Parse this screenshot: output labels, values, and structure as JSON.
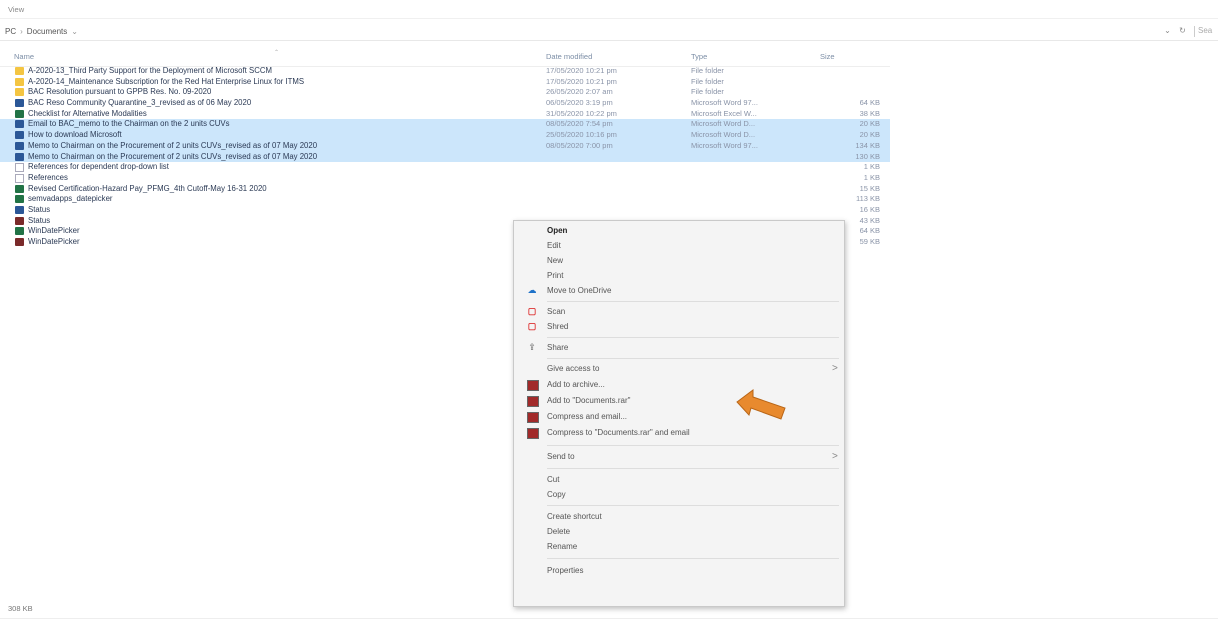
{
  "menubar": {
    "label": "View"
  },
  "address": {
    "crumbs": [
      "PC",
      "Documents"
    ],
    "refresh_glyph": "↻",
    "search_text": "Sea"
  },
  "columns": {
    "name": "Name",
    "date": "Date modified",
    "type": "Type",
    "size": "Size"
  },
  "files": [
    {
      "icon": "folder",
      "name": "A-2020-13_Third Party Support for the Deployment of Microsoft SCCM",
      "date": "17/05/2020 10:21 pm",
      "type": "File folder",
      "size": "",
      "selected": false
    },
    {
      "icon": "folder",
      "name": "A-2020-14_Maintenance Subscription for the Red Hat Enterprise Linux for ITMS",
      "date": "17/05/2020 10:21 pm",
      "type": "File folder",
      "size": "",
      "selected": false
    },
    {
      "icon": "folder",
      "name": "BAC Resolution pursuant to GPPB Res. No. 09-2020",
      "date": "26/05/2020 2:07 am",
      "type": "File folder",
      "size": "",
      "selected": false
    },
    {
      "icon": "word",
      "name": "BAC Reso Community Quarantine_3_revised as of 06 May 2020",
      "date": "06/05/2020 3:19 pm",
      "type": "Microsoft Word 97...",
      "size": "64 KB",
      "selected": false
    },
    {
      "icon": "excel",
      "name": "Checklist for Alternative Modalities",
      "date": "31/05/2020 10:22 pm",
      "type": "Microsoft Excel W...",
      "size": "38 KB",
      "selected": false
    },
    {
      "icon": "word",
      "name": "Email to BAC_memo to the Chairman on the 2 units CUVs",
      "date": "08/05/2020 7:54 pm",
      "type": "Microsoft Word D...",
      "size": "20 KB",
      "selected": true
    },
    {
      "icon": "word",
      "name": "How to download Microsoft",
      "date": "25/05/2020 10:16 pm",
      "type": "Microsoft Word D...",
      "size": "20 KB",
      "selected": true
    },
    {
      "icon": "word",
      "name": "Memo to Chairman on the Procurement of 2 units CUVs_revised as of 07 May 2020",
      "date": "08/05/2020 7:00 pm",
      "type": "Microsoft Word 97...",
      "size": "134 KB",
      "selected": true
    },
    {
      "icon": "word",
      "name": "Memo to Chairman on the Procurement of 2 units CUVs_revised as of 07 May 2020",
      "date": "",
      "type": "",
      "size": "130 KB",
      "selected": true
    },
    {
      "icon": "text",
      "name": "References for dependent drop-down list",
      "date": "",
      "type": "",
      "size": "1 KB",
      "selected": false
    },
    {
      "icon": "text",
      "name": "References",
      "date": "",
      "type": "",
      "size": "1 KB",
      "selected": false
    },
    {
      "icon": "excel",
      "name": "Revised Certification-Hazard Pay_PFMG_4th Cutoff-May 16-31 2020",
      "date": "",
      "type": "",
      "size": "15 KB",
      "selected": false
    },
    {
      "icon": "excel",
      "name": "semvadapps_datepicker",
      "date": "",
      "type": "",
      "size": "113 KB",
      "selected": false
    },
    {
      "icon": "word",
      "name": "Status",
      "date": "",
      "type": "",
      "size": "16 KB",
      "selected": false
    },
    {
      "icon": "app",
      "name": "Status",
      "date": "",
      "type": "",
      "size": "43 KB",
      "selected": false
    },
    {
      "icon": "excel",
      "name": "WinDatePicker",
      "date": "",
      "type": "",
      "size": "64 KB",
      "selected": false
    },
    {
      "icon": "app",
      "name": "WinDatePicker",
      "date": "",
      "type": "",
      "size": "59 KB",
      "selected": false
    }
  ],
  "context_menu": {
    "open": "Open",
    "edit": "Edit",
    "new": "New",
    "print": "Print",
    "onedrive": "Move to OneDrive",
    "scan": "Scan",
    "shred": "Shred",
    "share": "Share",
    "give_access": "Give access to",
    "add_archive": "Add to archive...",
    "add_rar": "Add to \"Documents.rar\"",
    "compress_email": "Compress and email...",
    "compress_rar_email": "Compress to \"Documents.rar\" and email",
    "send_to": "Send to",
    "cut": "Cut",
    "copy": "Copy",
    "create_shortcut": "Create shortcut",
    "delete": "Delete",
    "rename": "Rename",
    "properties": "Properties",
    "submenu_arrow": ">"
  },
  "status": {
    "text": "308 KB"
  },
  "colors": {
    "selection": "#cce6fb",
    "pointer": "#e88a2e"
  }
}
